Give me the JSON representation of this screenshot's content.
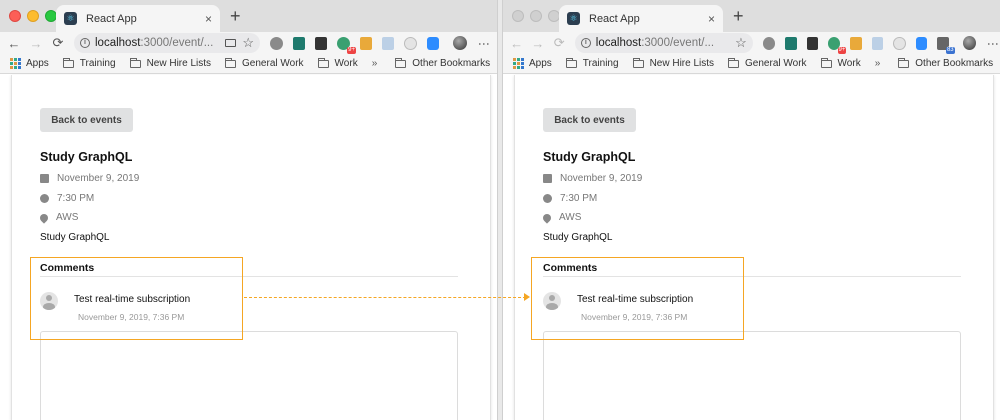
{
  "colors": {
    "highlight": "#f5a623",
    "button_bg": "#e0e1e2",
    "page_bg": "#ffffff",
    "chrome_bg": "#dedede"
  },
  "browser": {
    "tab_title": "React App",
    "tab_close": "×",
    "new_tab": "+",
    "url_host": "localhost",
    "url_path": ":3000/event/...",
    "back_icon": "←",
    "forward_icon": "→",
    "reload_icon": "⟳",
    "bookmark_star": "☆",
    "ext_badge_1": "9+",
    "ext_badge_2": "83",
    "menu_icon": "⋮",
    "bookmarks": {
      "apps": "Apps",
      "items": [
        "Training",
        "New Hire Lists",
        "General Work",
        "Work"
      ],
      "overflow": "»",
      "other": "Other Bookmarks"
    }
  },
  "event": {
    "back_button": "Back to events",
    "title": "Study GraphQL",
    "date": "November 9, 2019",
    "time": "7:30 PM",
    "location": "AWS",
    "description": "Study GraphQL"
  },
  "comments": {
    "header": "Comments",
    "items": [
      {
        "text": "Test real-time subscription",
        "date": "November 9, 2019, 7:36 PM"
      }
    ]
  }
}
